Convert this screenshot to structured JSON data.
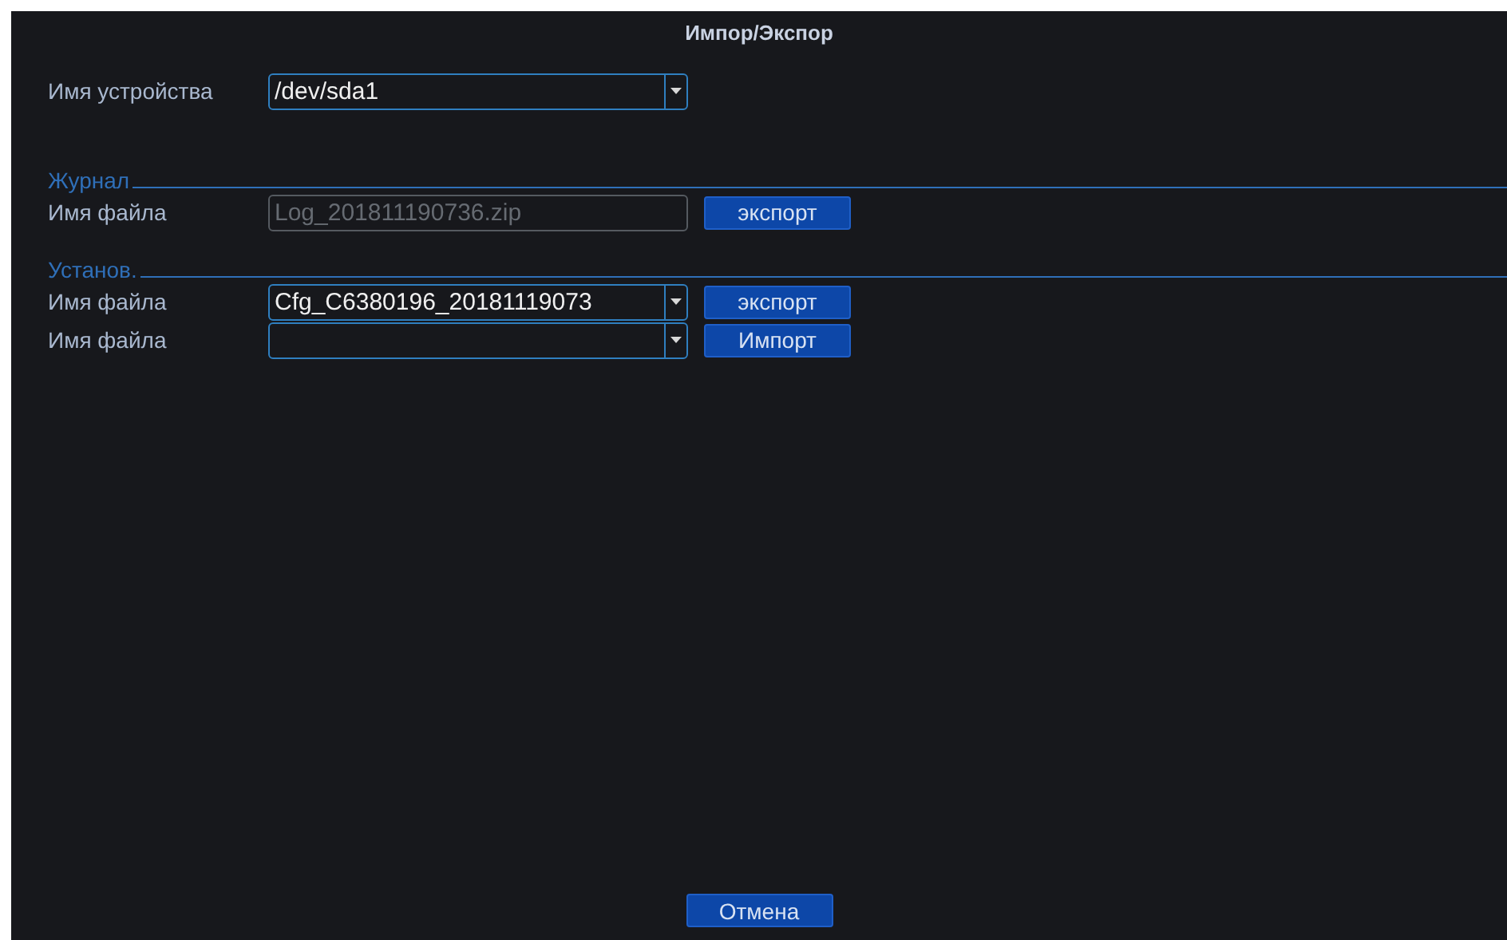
{
  "window": {
    "title": "Импор/Экспор"
  },
  "device": {
    "label": "Имя устройства",
    "kind": "dropdown",
    "value": "/dev/sda1"
  },
  "sections": [
    {
      "title": "Журнал",
      "rows": [
        {
          "label": "Имя файла",
          "kind": "text",
          "value": "Log_201811190736.zip",
          "disabled": true,
          "button": "экспорт"
        }
      ]
    },
    {
      "title": "Установ.",
      "rows": [
        {
          "label": "Имя файла",
          "kind": "dropdown",
          "value": "Cfg_C6380196_20181119073",
          "disabled": false,
          "button": "экспорт"
        },
        {
          "label": "Имя файла",
          "kind": "dropdown",
          "value": "",
          "disabled": false,
          "button": "Импорт"
        }
      ]
    }
  ],
  "cancel_button": "Отмена"
}
